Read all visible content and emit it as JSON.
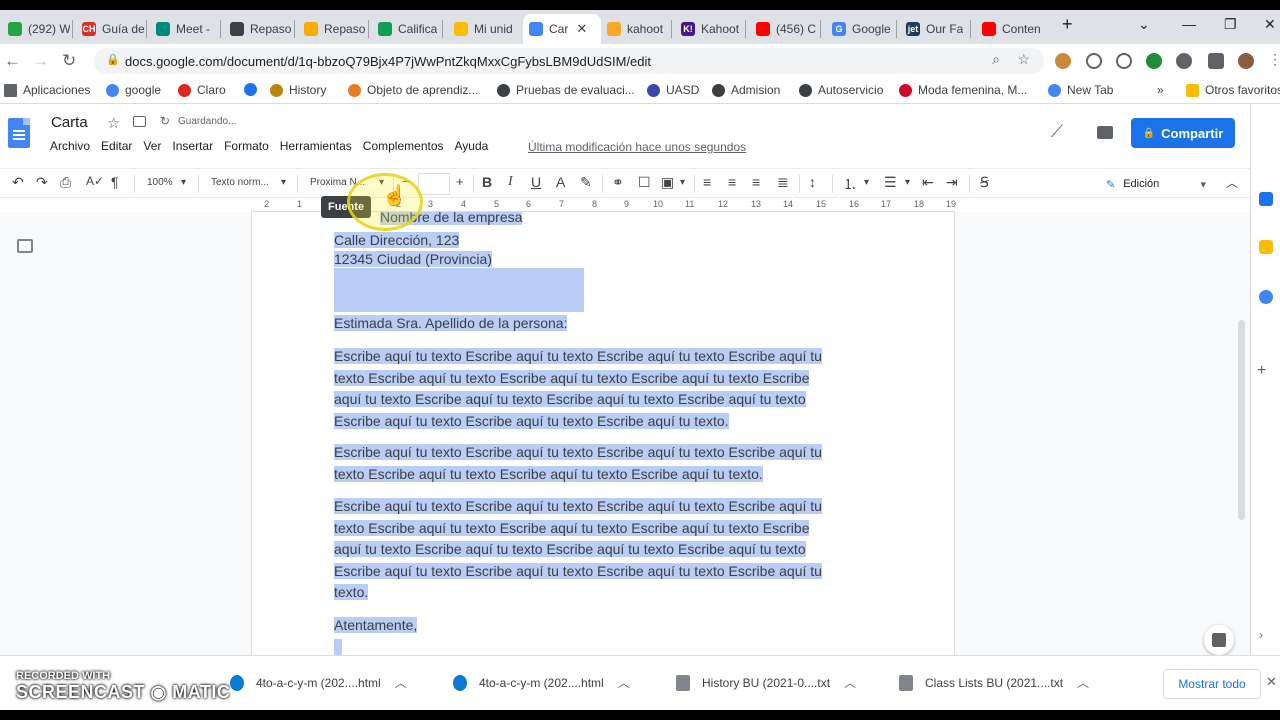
{
  "browser": {
    "tabs": [
      {
        "title": "(292) W",
        "color": "#25a244"
      },
      {
        "title": "Guía de",
        "color": "#d93025",
        "glyph": "CH"
      },
      {
        "title": "Meet -",
        "color": "#00897b"
      },
      {
        "title": "Repaso",
        "color": "#3c4043"
      },
      {
        "title": "Repaso",
        "color": "#f9ab00"
      },
      {
        "title": "Califica",
        "color": "#0f9d58"
      },
      {
        "title": "Mi unid",
        "color": "#fbbc04"
      },
      {
        "title": "Car",
        "color": "#4285f4",
        "active": true,
        "close": "✕"
      },
      {
        "title": "kahoot",
        "color": "#f9a825"
      },
      {
        "title": "Kahoot",
        "color": "#46178f",
        "glyph": "K!"
      },
      {
        "title": "(456) C",
        "color": "#ff0000"
      },
      {
        "title": "Google",
        "color": "#4285f4",
        "glyph": "G"
      },
      {
        "title": "Our Fa",
        "color": "#1f3b57",
        "glyph": "jet"
      },
      {
        "title": "Conten",
        "color": "#ff0000"
      }
    ],
    "new_tab": "+",
    "url": "docs.google.com/document/d/1q-bbzoQ79Bjx4P7jWwPntZkqMxxCgFybsLBM9dUdSIM/edit",
    "bookmarks": [
      {
        "label": "Aplicaciones",
        "color": "#5f6368"
      },
      {
        "label": "google",
        "color": "#4285f4"
      },
      {
        "label": "Claro",
        "color": "#da291c"
      },
      {
        "label": "",
        "color": "#1a73e8"
      },
      {
        "label": "History",
        "color": "#b8860b"
      },
      {
        "label": "Objeto de aprendiz...",
        "color": "#e67c23"
      },
      {
        "label": "Pruebas de evaluaci...",
        "color": "#3c4043"
      },
      {
        "label": "UASD",
        "color": "#3949ab"
      },
      {
        "label": "Admision",
        "color": "#3c4043"
      },
      {
        "label": "Autoservicio",
        "color": "#3c4043"
      },
      {
        "label": "Moda femenina, M...",
        "color": "#cf0a2c"
      },
      {
        "label": "New Tab",
        "color": "#4285f4"
      }
    ],
    "bookmarks_more": "»",
    "other_bookmarks": "Otros favoritos"
  },
  "docs": {
    "title": "Carta",
    "saving_status": "Guardando...",
    "menu": [
      "Archivo",
      "Editar",
      "Ver",
      "Insertar",
      "Formato",
      "Herramientas",
      "Complementos",
      "Ayuda"
    ],
    "last_edit": "Última modificación hace unos segundos",
    "share_label": "Compartir",
    "toolbar": {
      "zoom": "100%",
      "style": "Texto norm...",
      "font": "Proxima N...",
      "font_tooltip": "Fuente",
      "bold": "B",
      "italic": "I",
      "underline": "U",
      "text_color": "A",
      "mode": "Edición"
    },
    "ruler_numbers": [
      "2",
      "1",
      "1",
      "2",
      "3",
      "4",
      "5",
      "6",
      "7",
      "8",
      "9",
      "10",
      "11",
      "12",
      "13",
      "14",
      "15",
      "16",
      "17",
      "18",
      "19"
    ],
    "body": {
      "company_line": "Nombre de la empresa",
      "address1": "Calle Dirección, 123",
      "address2": "12345 Ciudad (Provincia)",
      "greeting": "Estimada Sra. Apellido de la persona:",
      "p1": [
        "Escribe aquí tu texto Escribe aquí tu texto Escribe aquí tu texto Escribe aquí tu",
        "texto Escribe aquí tu texto Escribe aquí tu texto Escribe aquí tu texto Escribe",
        "aquí tu texto Escribe aquí tu texto Escribe aquí tu texto Escribe aquí tu texto",
        "Escribe aquí tu texto Escribe aquí tu texto Escribe aquí tu texto."
      ],
      "p2": [
        "Escribe aquí tu texto Escribe aquí tu texto Escribe aquí tu texto Escribe aquí tu",
        "texto Escribe aquí tu texto Escribe aquí tu texto Escribe aquí tu texto."
      ],
      "p3": [
        "Escribe aquí tu texto Escribe aquí tu texto Escribe aquí tu texto Escribe aquí tu",
        "texto Escribe aquí tu texto Escribe aquí tu texto Escribe aquí tu texto Escribe",
        "aquí tu texto Escribe aquí tu texto Escribe aquí tu texto Escribe aquí tu texto",
        "Escribe aquí tu texto Escribe aquí tu texto Escribe aquí tu texto Escribe aquí tu",
        "texto."
      ],
      "closing": "Atentamente,"
    }
  },
  "downloads": {
    "items": [
      {
        "name": "4to-a-c-y-m (202....html",
        "color": "#0a7ad6"
      },
      {
        "name": "4to-a-c-y-m (202....html",
        "color": "#0a7ad6"
      },
      {
        "name": "History BU (2021-0....txt",
        "color": "#80868b"
      },
      {
        "name": "Class Lists BU (2021....txt",
        "color": "#80868b"
      }
    ],
    "show_all": "Mostrar todo"
  },
  "watermark": {
    "top": "RECORDED WITH",
    "main": "SCREENCAST ◉ MATIC"
  }
}
